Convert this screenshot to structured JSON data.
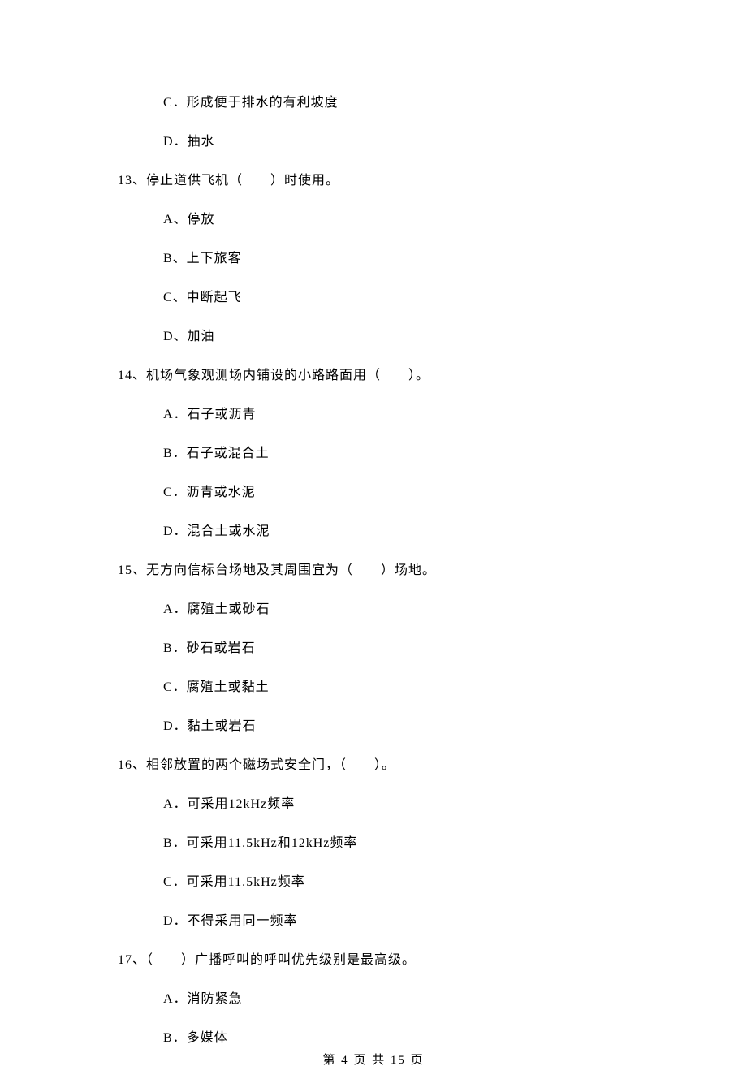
{
  "orphan_options": {
    "c": "C．形成便于排水的有利坡度",
    "d": "D．抽水"
  },
  "q13": {
    "stem": "13、停止道供飞机（　　）时使用。",
    "a": "A、停放",
    "b": "B、上下旅客",
    "c": "C、中断起飞",
    "d": "D、加油"
  },
  "q14": {
    "stem": "14、机场气象观测场内铺设的小路路面用（　　）。",
    "a": "A．石子或沥青",
    "b": "B．石子或混合土",
    "c": "C．沥青或水泥",
    "d": "D．混合土或水泥"
  },
  "q15": {
    "stem": "15、无方向信标台场地及其周围宜为（　　）场地。",
    "a": "A．腐殖土或砂石",
    "b": "B．砂石或岩石",
    "c": "C．腐殖土或黏土",
    "d": "D．黏土或岩石"
  },
  "q16": {
    "stem": "16、相邻放置的两个磁场式安全门，（　　）。",
    "a": "A．可采用12kHz频率",
    "b": "B．可采用11.5kHz和12kHz频率",
    "c": "C．可采用11.5kHz频率",
    "d": "D．不得采用同一频率"
  },
  "q17": {
    "stem": "17、（　　）广播呼叫的呼叫优先级别是最高级。",
    "a": "A．消防紧急",
    "b": "B．多媒体"
  },
  "footer": "第 4 页 共 15 页"
}
